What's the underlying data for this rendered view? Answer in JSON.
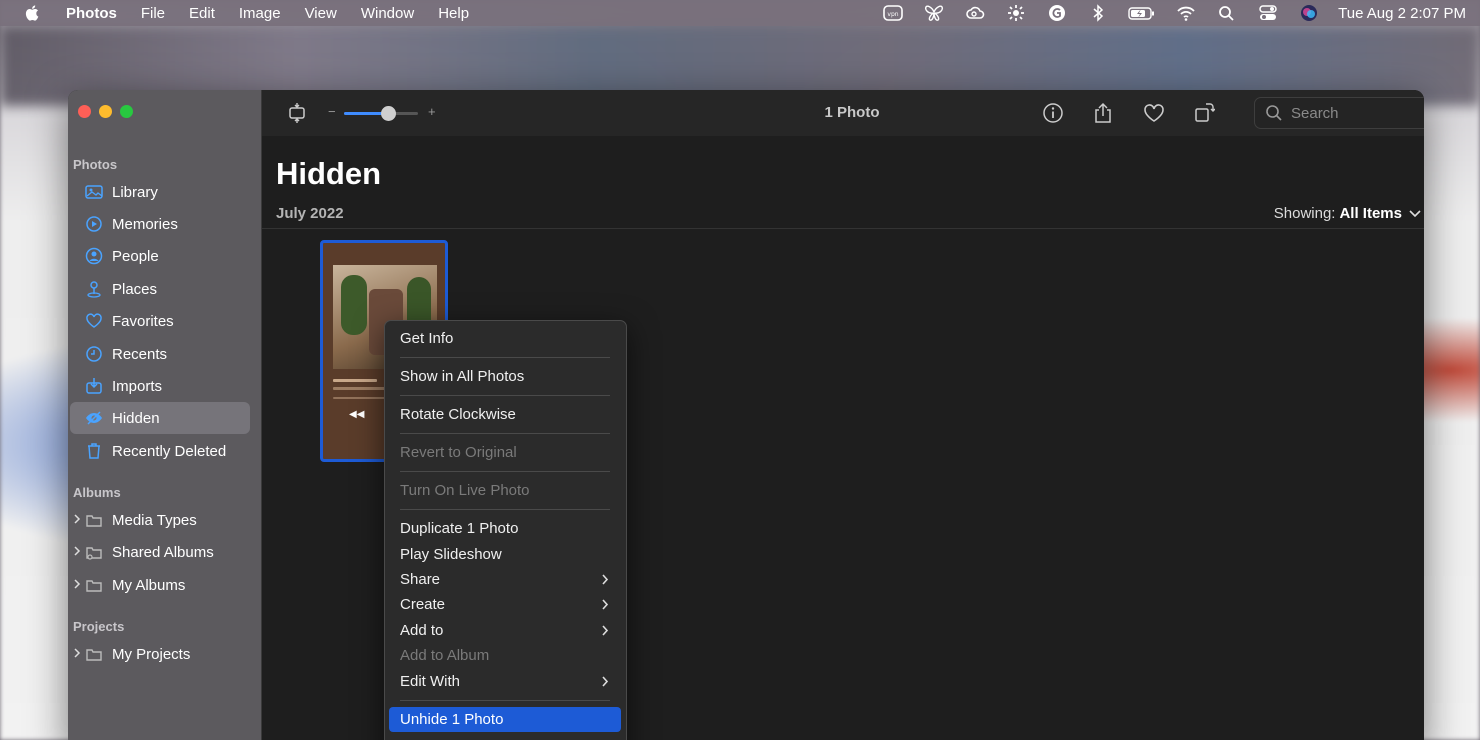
{
  "menubar": {
    "app_name": "Photos",
    "items": [
      "File",
      "Edit",
      "Image",
      "View",
      "Window",
      "Help"
    ],
    "status_icons": [
      "vpn-icon",
      "butterfly-icon",
      "creative-cloud-icon",
      "sparkle-icon",
      "grammarly-icon",
      "bluetooth-icon",
      "battery-icon",
      "wifi-icon",
      "spotlight-search-icon",
      "control-center-icon",
      "siri-icon"
    ],
    "vpn_label": "vpn",
    "clock": "Tue Aug 2  2:07 PM"
  },
  "sidebar": {
    "sections": {
      "photos": "Photos",
      "albums": "Albums",
      "projects": "Projects"
    },
    "photos_items": [
      {
        "label": "Library",
        "icon": "library-icon"
      },
      {
        "label": "Memories",
        "icon": "memories-icon"
      },
      {
        "label": "People",
        "icon": "people-icon"
      },
      {
        "label": "Places",
        "icon": "places-icon"
      },
      {
        "label": "Favorites",
        "icon": "favorites-icon"
      },
      {
        "label": "Recents",
        "icon": "recents-icon"
      },
      {
        "label": "Imports",
        "icon": "imports-icon"
      },
      {
        "label": "Hidden",
        "icon": "hidden-icon",
        "selected": true
      },
      {
        "label": "Recently Deleted",
        "icon": "trash-icon"
      }
    ],
    "album_items": [
      {
        "label": "Media Types"
      },
      {
        "label": "Shared Albums"
      },
      {
        "label": "My Albums"
      }
    ],
    "project_items": [
      {
        "label": "My Projects"
      }
    ]
  },
  "toolbar": {
    "title": "1 Photo",
    "zoom_minus": "−",
    "zoom_plus": "+",
    "zoom_level": 0.6,
    "search_placeholder": "Search"
  },
  "content": {
    "title": "Hidden",
    "date_section": "July 2022",
    "showing_label": "Showing:",
    "showing_value": "All Items"
  },
  "context_menu": {
    "items": [
      {
        "label": "Get Info",
        "disabled": false
      },
      {
        "label": "Show in All Photos",
        "disabled": false
      },
      {
        "label": "Rotate Clockwise",
        "disabled": false
      },
      {
        "label": "Revert to Original",
        "disabled": true
      },
      {
        "label": "Turn On Live Photo",
        "disabled": true
      },
      {
        "label": "Duplicate 1 Photo",
        "disabled": false
      },
      {
        "label": "Play Slideshow",
        "disabled": false
      },
      {
        "label": "Share",
        "disabled": false,
        "submenu": true
      },
      {
        "label": "Create",
        "disabled": false,
        "submenu": true
      },
      {
        "label": "Add to",
        "disabled": false,
        "submenu": true
      },
      {
        "label": "Add to Album",
        "disabled": true
      },
      {
        "label": "Edit With",
        "disabled": false,
        "submenu": true
      },
      {
        "label": "Unhide 1 Photo",
        "disabled": false,
        "highlighted": true
      }
    ]
  },
  "colors": {
    "accent": "#1d5bd6",
    "sidebar_icon": "#4aa3ff"
  }
}
